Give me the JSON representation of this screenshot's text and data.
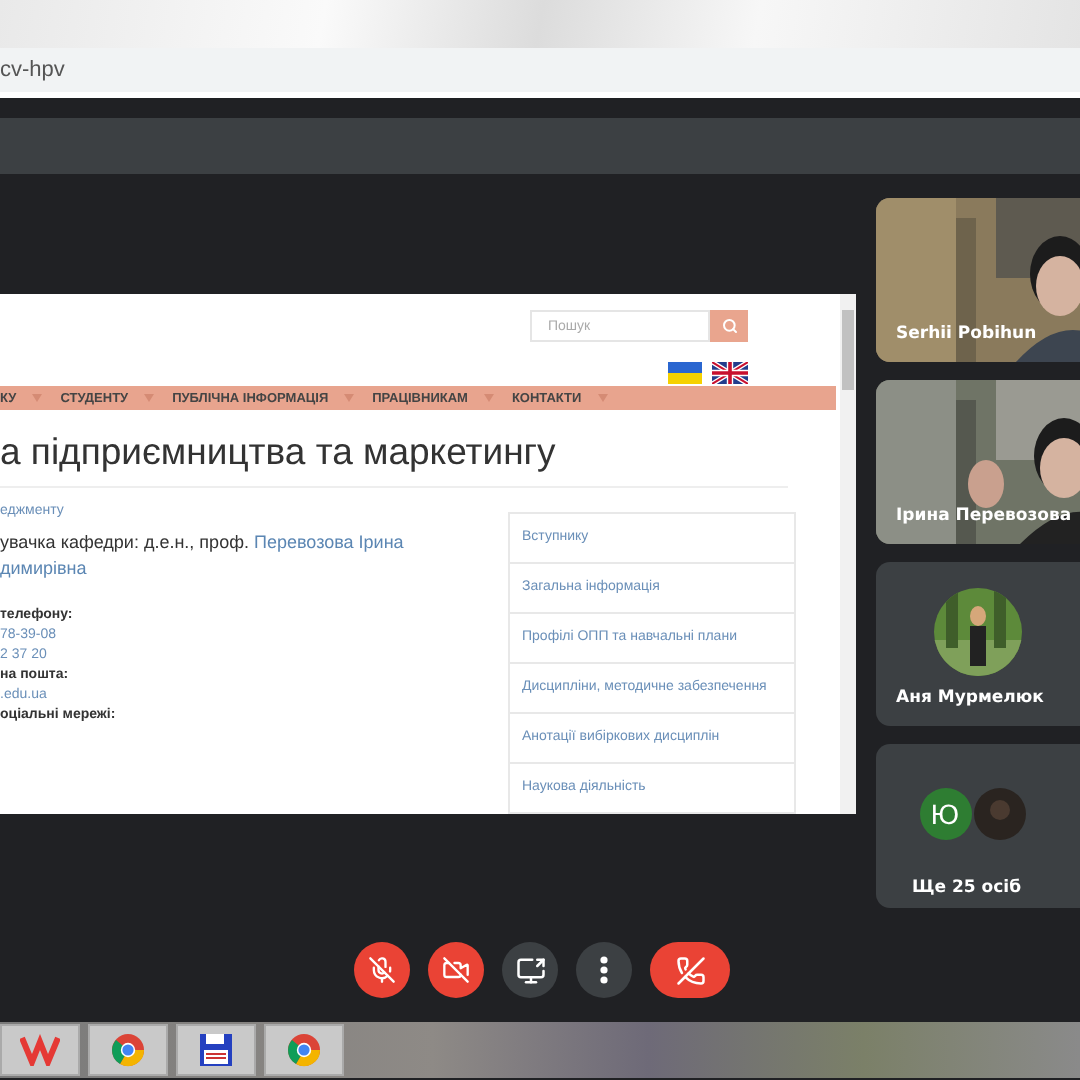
{
  "browser": {
    "address": "cv-hpv"
  },
  "presentation": {
    "search_placeholder": "Пошук",
    "nav": [
      "КУ",
      "СТУДЕНТУ",
      "ПУБЛІЧНА ІНФОРМАЦІЯ",
      "ПРАЦІВНИКАМ",
      "КОНТАКТИ"
    ],
    "title": "а підприємництва та маркетингу",
    "breadcrumb": "еджменту",
    "head_text": "увачка кафедри: д.е.н., проф.",
    "head_link": "Перевозова Ірина",
    "head_link_2": "димирівна",
    "contacts": [
      {
        "kind": "label",
        "text": "телефону:"
      },
      {
        "kind": "link",
        "text": "78-39-08"
      },
      {
        "kind": "link",
        "text": "2 37 20"
      },
      {
        "kind": "label",
        "text": "на пошта:"
      },
      {
        "kind": "link",
        "text": ".edu.ua"
      },
      {
        "kind": "label",
        "text": "оціальні мережі:"
      }
    ],
    "menu": [
      "Вступнику",
      "Загальна інформація",
      "Профілі ОПП та навчальні плани",
      "Дисципліни, методичне забезпечення",
      "Анотації вибіркових дисциплін",
      "Наукова діяльність"
    ]
  },
  "participants": [
    {
      "kind": "video",
      "name": "Serhii Pobihun"
    },
    {
      "kind": "video",
      "name": "Ірина Перевозова"
    },
    {
      "kind": "avatar",
      "name": "Аня Мурмелюк"
    }
  ],
  "more": {
    "initial": "Ю",
    "label": "Ще 25 осіб"
  },
  "controls": [
    {
      "kind": "mic",
      "muted": true
    },
    {
      "kind": "camera",
      "muted": true
    },
    {
      "kind": "present"
    },
    {
      "kind": "more"
    },
    {
      "kind": "hangup"
    }
  ]
}
